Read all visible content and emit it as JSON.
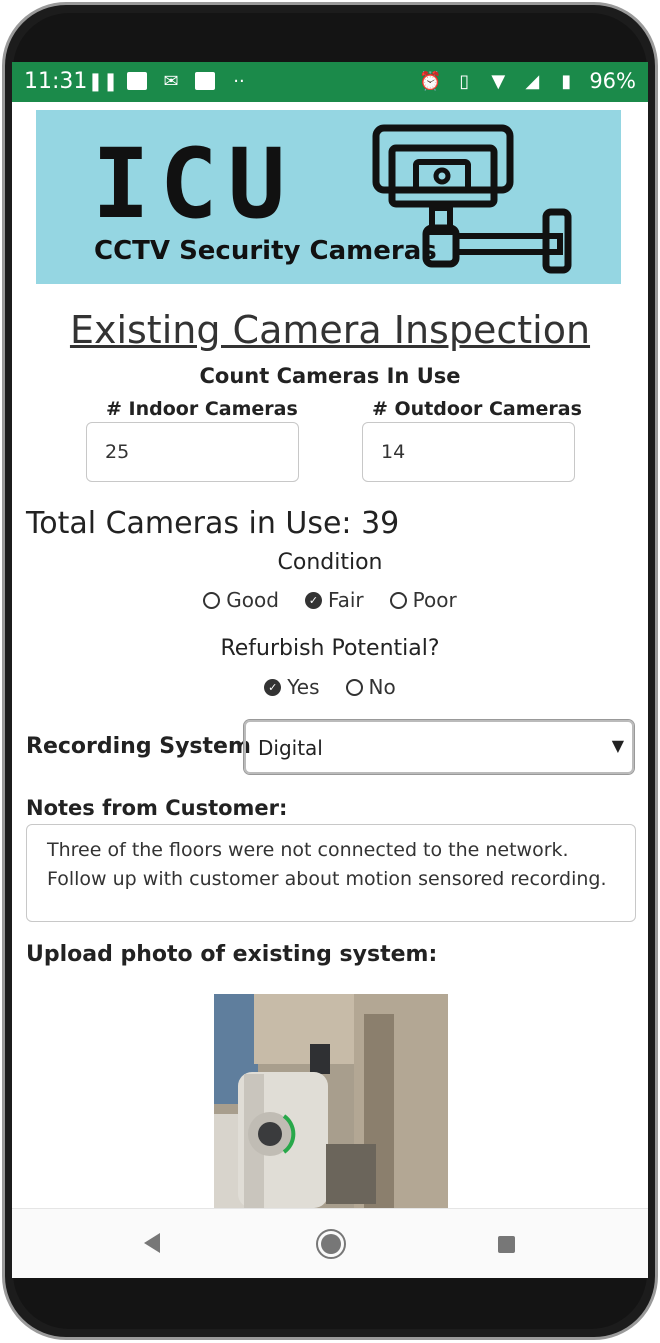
{
  "status_bar": {
    "time": "11:31",
    "battery": "96%"
  },
  "banner": {
    "logo_text": "ICU",
    "logo_subtitle": "CCTV Security Cameras",
    "bg_color": "#95d6e2"
  },
  "page": {
    "title": "Existing Camera Inspection",
    "count_heading": "Count Cameras In Use"
  },
  "counts": {
    "indoor_label": "# Indoor Cameras",
    "indoor_value": "25",
    "outdoor_label": "# Outdoor Cameras",
    "outdoor_value": "14",
    "total_text": "Total Cameras in Use: 39"
  },
  "condition": {
    "heading": "Condition",
    "options": [
      "Good",
      "Fair",
      "Poor"
    ],
    "selected": "Fair"
  },
  "refurbish": {
    "heading": "Refurbish Potential?",
    "options": [
      "Yes",
      "No"
    ],
    "selected": "Yes"
  },
  "recording": {
    "label": "Recording System",
    "selected": "Digital"
  },
  "notes": {
    "label": "Notes from Customer:",
    "line1": "Three of the floors were not connected to the network.",
    "line2": "Follow up with customer about motion sensored recording."
  },
  "upload": {
    "label": "Upload photo of existing system:"
  },
  "colors": {
    "status_bar": "#1b8a4a",
    "text": "#222222"
  }
}
